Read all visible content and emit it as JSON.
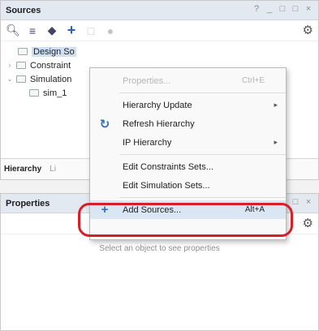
{
  "sources": {
    "title": "Sources",
    "window_controls": [
      "?",
      "_",
      "□",
      "□",
      "×"
    ],
    "toolbar": [
      "search-icon",
      "collapse-all-icon",
      "expand-icon",
      "add-icon",
      "file-icon",
      "record-icon"
    ],
    "tree": [
      {
        "label": "Design So",
        "expander": "",
        "selected": true
      },
      {
        "label": "Constraint",
        "expander": "›",
        "selected": false
      },
      {
        "label": "Simulation",
        "expander": "⌄",
        "selected": false
      },
      {
        "label": "sim_1",
        "expander": "",
        "selected": false
      }
    ],
    "tabs": [
      "Hierarchy",
      "Li"
    ]
  },
  "properties": {
    "title": "Properties",
    "empty_message": "Select an object to see properties"
  },
  "context_menu": {
    "items": [
      {
        "label": "Properties...",
        "shortcut": "Ctrl+E",
        "disabled": true
      },
      {
        "label": "Hierarchy Update",
        "submenu": true
      },
      {
        "label": "Refresh Hierarchy",
        "icon": "refresh-icon"
      },
      {
        "label": "IP Hierarchy",
        "submenu": true
      },
      {
        "label": "Edit Constraints Sets..."
      },
      {
        "label": "Edit Simulation Sets..."
      },
      {
        "label": "Add Sources...",
        "shortcut": "Alt+A",
        "icon": "add-icon",
        "highlighted": true
      }
    ]
  },
  "colors": {
    "annotation": "#d61f26",
    "accent": "#2b63b3"
  }
}
